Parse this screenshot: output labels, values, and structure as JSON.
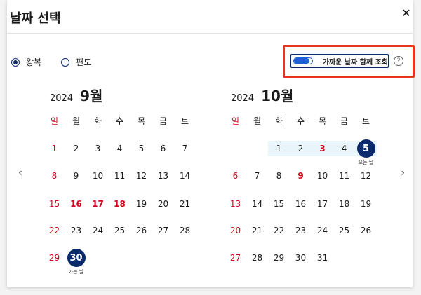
{
  "dialog": {
    "title": "날짜 선택",
    "close_label": "✕"
  },
  "trip_type": {
    "options": [
      {
        "label": "왕복",
        "selected": true
      },
      {
        "label": "편도",
        "selected": false
      }
    ]
  },
  "nearby_toggle": {
    "label": "가까운 날짜 함께 조회",
    "help_label": "?"
  },
  "calendar": {
    "weekdays": [
      "일",
      "월",
      "화",
      "수",
      "목",
      "금",
      "토"
    ],
    "prev_icon": "‹",
    "next_icon": "›",
    "months": [
      {
        "year": "2024",
        "month": "9월",
        "weeks": [
          [
            "1",
            "2",
            "3",
            "4",
            "5",
            "6",
            "7"
          ],
          [
            "8",
            "9",
            "10",
            "11",
            "12",
            "13",
            "14"
          ],
          [
            "15",
            "16",
            "17",
            "18",
            "19",
            "20",
            "21"
          ],
          [
            "22",
            "23",
            "24",
            "25",
            "26",
            "27",
            "28"
          ],
          [
            "29",
            "30",
            "",
            "",
            "",
            "",
            ""
          ]
        ],
        "holidays": [
          "16",
          "17",
          "18"
        ],
        "selected": {
          "day": "30",
          "label": "가는 날"
        }
      },
      {
        "year": "2024",
        "month": "10월",
        "weeks": [
          [
            "",
            "",
            "1",
            "2",
            "3",
            "4",
            "5"
          ],
          [
            "6",
            "7",
            "8",
            "9",
            "10",
            "11",
            "12"
          ],
          [
            "13",
            "14",
            "15",
            "16",
            "17",
            "18",
            "19"
          ],
          [
            "20",
            "21",
            "22",
            "23",
            "24",
            "25",
            "26"
          ],
          [
            "27",
            "28",
            "29",
            "30",
            "31",
            "",
            ""
          ]
        ],
        "holidays": [
          "3",
          "9"
        ],
        "range_days": [
          "1",
          "2",
          "3",
          "4"
        ],
        "selected": {
          "day": "5",
          "label": "오는 날"
        }
      }
    ]
  }
}
